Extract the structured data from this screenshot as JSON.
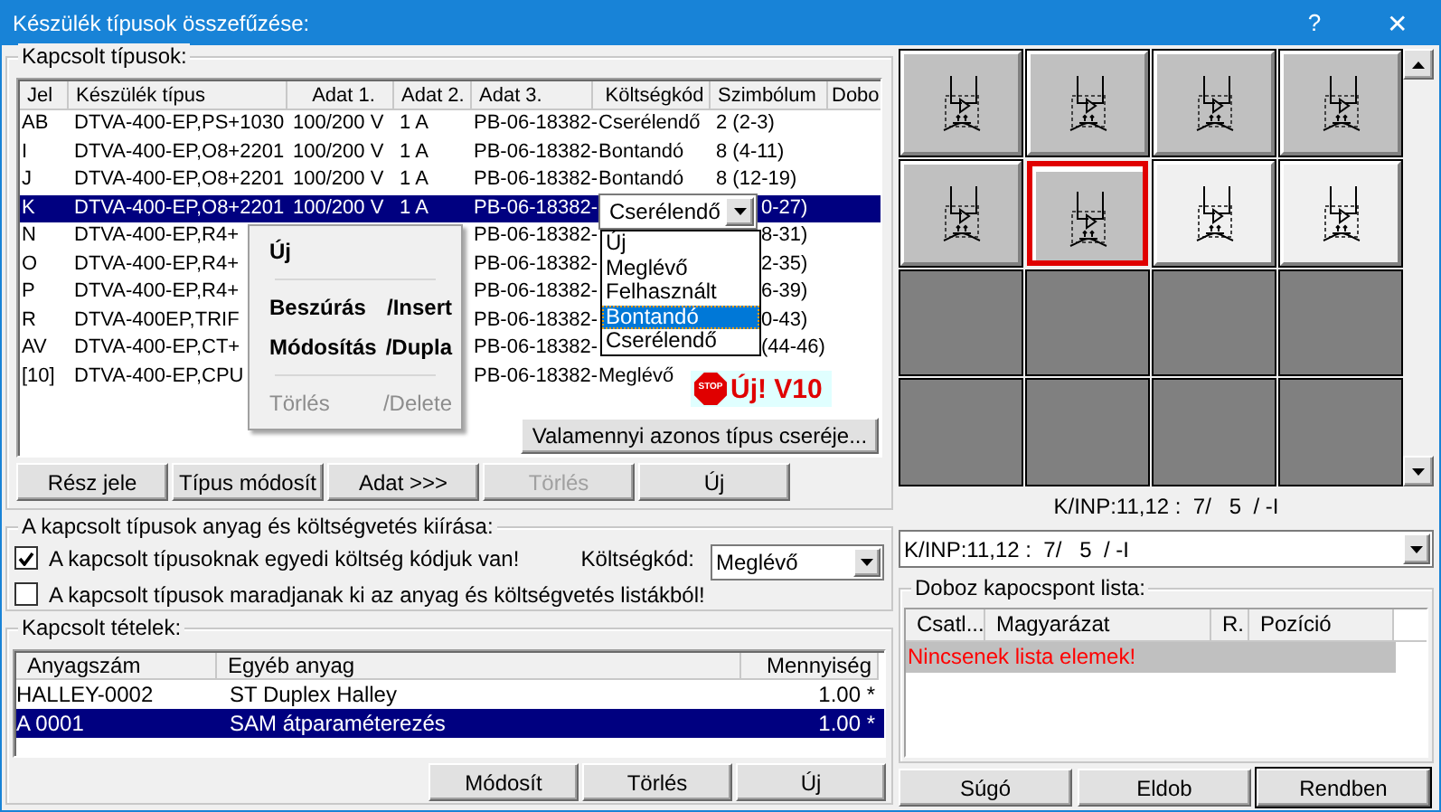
{
  "window": {
    "title": "Készülék típusok összefűzése:",
    "help": "?",
    "close": "✕"
  },
  "types_group": {
    "title": "Kapcsolt típusok:",
    "columns": [
      "Jel",
      "Készülék típus",
      "Adat 1.",
      "Adat 2.",
      "Adat 3.",
      "Költségkód",
      "Szimbólum",
      "Dobo"
    ],
    "rows": [
      {
        "jel": "AB",
        "tipus": "DTVA-400-EP,PS+1030",
        "adat1": "100/200 V",
        "adat2": "1 A",
        "adat3": "PB-06-18382-",
        "koltseg": "Cserélendő",
        "szimbolum": "2 (2-3)",
        "selected": false
      },
      {
        "jel": "I",
        "tipus": "DTVA-400-EP,O8+2201",
        "adat1": "100/200 V",
        "adat2": "1 A",
        "adat3": "PB-06-18382-",
        "koltseg": "Bontandó",
        "szimbolum": "8 (4-11)",
        "selected": false
      },
      {
        "jel": "J",
        "tipus": "DTVA-400-EP,O8+2201",
        "adat1": "100/200 V",
        "adat2": "1 A",
        "adat3": "PB-06-18382-",
        "koltseg": "Bontandó",
        "szimbolum": "8 (12-19)",
        "selected": false
      },
      {
        "jel": "K",
        "tipus": "DTVA-400-EP,O8+2201",
        "adat1": "100/200 V",
        "adat2": "1 A",
        "adat3": "PB-06-18382-",
        "szimbolum": "0-27)",
        "selected": true
      },
      {
        "jel": "N",
        "tipus": "DTVA-400-EP,R4+",
        "adat3": "PB-06-18382-",
        "szimbolum": "8-31)",
        "selected": false
      },
      {
        "jel": "O",
        "tipus": "DTVA-400-EP,R4+",
        "adat3": "PB-06-18382-",
        "szimbolum": "2-35)",
        "selected": false
      },
      {
        "jel": "P",
        "tipus": "DTVA-400-EP,R4+",
        "adat3": "PB-06-18382-",
        "szimbolum": "6-39)",
        "selected": false
      },
      {
        "jel": "R",
        "tipus": "DTVA-400EP,TRIF",
        "adat3": "PB-06-18382-",
        "szimbolum": "0-43)",
        "selected": false
      },
      {
        "jel": "AV",
        "tipus": "DTVA-400-EP,CT+",
        "adat3": "PB-06-18382-",
        "szimbolum": "(44-46)",
        "selected": false
      },
      {
        "jel": "[10]",
        "tipus": "DTVA-400-EP,CPU",
        "adat3": "PB-06-18382-",
        "koltseg": "Meglévő",
        "selected": false
      }
    ],
    "cell_editor": {
      "value": "Cserélendő"
    },
    "dropdown": [
      {
        "label": "Új",
        "selected": false
      },
      {
        "label": "Meglévő",
        "selected": false
      },
      {
        "label": "Felhasznált",
        "selected": false
      },
      {
        "label": "Bontandó",
        "selected": true
      },
      {
        "label": "Cserélendő",
        "selected": false
      }
    ],
    "context_menu": [
      {
        "kind": "item",
        "label": "Új",
        "disabled": false
      },
      {
        "kind": "separator"
      },
      {
        "kind": "item",
        "label": "Beszúrás",
        "shortcut": "/Insert",
        "disabled": false
      },
      {
        "kind": "item",
        "label": "Módosítás",
        "shortcut": "/Dupla",
        "disabled": false
      },
      {
        "kind": "separator"
      },
      {
        "kind": "item",
        "label": "Törlés",
        "shortcut": "/Delete",
        "disabled": true
      }
    ],
    "badge": {
      "sign": "STOP",
      "text": "Új! V10"
    },
    "replace_button": "Valamennyi azonos típus cseréje...",
    "buttons": [
      {
        "label": "Rész jele",
        "disabled": false
      },
      {
        "label": "Típus módosít",
        "disabled": false
      },
      {
        "label": "Adat >>>",
        "disabled": false
      },
      {
        "label": "Törlés",
        "disabled": true
      },
      {
        "label": "Új",
        "disabled": false
      }
    ]
  },
  "cost_group": {
    "title": "A kapcsolt típusok anyag és költségvetés kiírása:",
    "checkboxes": [
      {
        "label": "A kapcsolt típusoknak egyedi költség kódjuk van!",
        "checked": true
      },
      {
        "label": "A kapcsolt típusok maradjanak ki az anyag és költségvetés listákból!",
        "checked": false
      }
    ],
    "cost_label": "Költségkód:",
    "cost_value": "Meglévő"
  },
  "items_group": {
    "title": "Kapcsolt tételek:",
    "columns": [
      "Anyagszám",
      "Egyéb anyag",
      "Mennyiség"
    ],
    "rows": [
      {
        "anyagszam": "HALLEY-0002",
        "egyeb": "ST Duplex Halley",
        "mennyiseg": "1.00 *",
        "selected": false
      },
      {
        "anyagszam": "A 0001",
        "egyeb": "SAM átparaméterezés",
        "mennyiseg": "1.00 *",
        "selected": true
      }
    ],
    "buttons": [
      "Módosít",
      "Törlés",
      "Új"
    ]
  },
  "tiles": [
    {
      "kind": "normal",
      "selected": false
    },
    {
      "kind": "normal",
      "selected": false
    },
    {
      "kind": "normal",
      "selected": false
    },
    {
      "kind": "normal",
      "selected": false
    },
    {
      "kind": "normal",
      "selected": false
    },
    {
      "kind": "normal",
      "selected": true
    },
    {
      "kind": "light",
      "selected": false
    },
    {
      "kind": "light",
      "selected": false
    },
    {
      "kind": "empty",
      "selected": false
    },
    {
      "kind": "empty",
      "selected": false
    },
    {
      "kind": "empty",
      "selected": false
    },
    {
      "kind": "empty",
      "selected": false
    },
    {
      "kind": "empty",
      "selected": false
    },
    {
      "kind": "empty",
      "selected": false
    },
    {
      "kind": "empty",
      "selected": false
    },
    {
      "kind": "empty",
      "selected": false
    }
  ],
  "position_label": "K/INP:11,12 :  7/   5  / -I",
  "position_combo": "K/INP:11,12 :  7/   5  / -I",
  "terminal_group": {
    "title": "Doboz kapocspont lista:",
    "columns": [
      "Csatl...",
      "Magyarázat",
      "R.",
      "Pozíció"
    ],
    "message": "Nincsenek lista elemek!"
  },
  "footer_buttons": [
    {
      "label": "Súgó",
      "default": false
    },
    {
      "label": "Eldob",
      "default": false
    },
    {
      "label": "Rendben",
      "default": true
    }
  ]
}
